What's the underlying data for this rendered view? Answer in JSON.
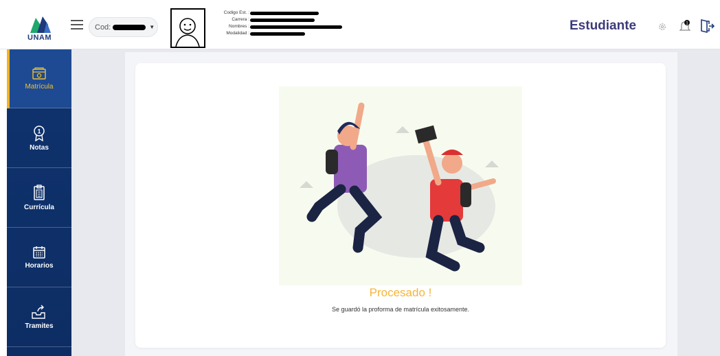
{
  "header": {
    "logo_text": "UNAM",
    "cod_label": "Cod:",
    "info_labels": [
      "Codigo Est. :",
      "Carrera :",
      "Nombres :",
      "Modalidad :"
    ],
    "role": "Estudiante"
  },
  "sidebar": {
    "items": [
      {
        "label": "Matrícula",
        "icon": "wallet-icon"
      },
      {
        "label": "Notas",
        "icon": "award-ribbon-icon"
      },
      {
        "label": "Currícula",
        "icon": "clipboard-icon"
      },
      {
        "label": "Horarios",
        "icon": "calendar-icon"
      },
      {
        "label": "Tramites",
        "icon": "inbox-share-icon"
      }
    ]
  },
  "main": {
    "title": "Procesado !",
    "message": "Se guardó la proforma de matrícula exitosamente."
  },
  "colors": {
    "sidebar": "#10336e",
    "active": "#1d4a93",
    "accent": "#f2b320",
    "title": "#f5b53b",
    "role": "#3c3a7a"
  }
}
